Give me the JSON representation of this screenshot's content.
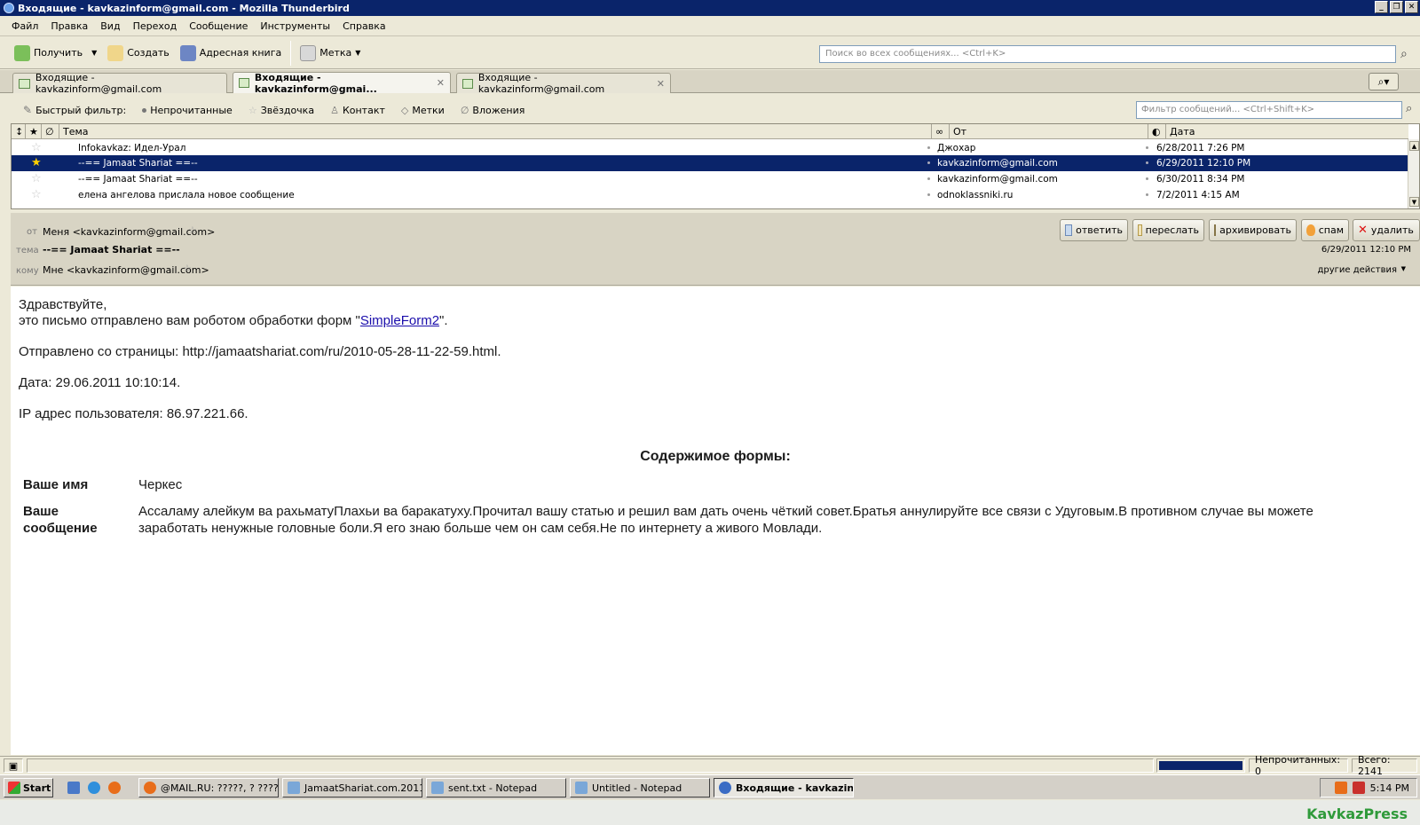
{
  "window": {
    "title": "Входящие - kavkazinform@gmail.com - Mozilla Thunderbird"
  },
  "menu": [
    "Файл",
    "Правка",
    "Вид",
    "Переход",
    "Сообщение",
    "Инструменты",
    "Справка"
  ],
  "toolbar": {
    "get": "Получить",
    "compose": "Создать",
    "addressbook": "Адресная книга",
    "tag": "Метка",
    "search_placeholder": "Поиск во всех сообщениях... <Ctrl+K>"
  },
  "tabs": [
    {
      "label": "Входящие - kavkazinform@gmail.com"
    },
    {
      "label": "Входящие - kavkazinform@gmai..."
    },
    {
      "label": "Входящие - kavkazinform@gmail.com"
    }
  ],
  "quickfilter": {
    "label": "Быстрый фильтр:",
    "unread": "Непрочитанные",
    "starred": "Звёздочка",
    "contact": "Контакт",
    "tags": "Метки",
    "attachments": "Вложения",
    "filter_placeholder": "Фильтр сообщений... <Ctrl+Shift+K>"
  },
  "list": {
    "columns": {
      "subject": "Тема",
      "from": "От",
      "date": "Дата"
    },
    "rows": [
      {
        "subject": "Infokavkaz: Идел-Урал",
        "from": "Джохар",
        "date": "6/28/2011 7:26 PM"
      },
      {
        "subject": "--== Jamaat Shariat ==--",
        "from": "kavkazinform@gmail.com",
        "date": "6/29/2011 12:10 PM"
      },
      {
        "subject": "--== Jamaat Shariat ==--",
        "from": "kavkazinform@gmail.com",
        "date": "6/30/2011 8:34 PM"
      },
      {
        "subject": "елена ангелова прислала новое сообщение",
        "from": "odnoklassniki.ru",
        "date": "7/2/2011 4:15 AM"
      }
    ]
  },
  "header": {
    "from_label": "от",
    "from_value": "Меня <kavkazinform@gmail.com>",
    "subject_label": "тема",
    "subject_value": "--== Jamaat Shariat ==--",
    "to_label": "кому",
    "to_value": "Мне <kavkazinform@gmail.com>",
    "date": "6/29/2011 12:10 PM",
    "other_actions": "другие действия",
    "buttons": {
      "reply": "ответить",
      "forward": "переслать",
      "archive": "архивировать",
      "spam": "спам",
      "delete": "удалить"
    }
  },
  "body": {
    "greeting": "Здравствуйте,",
    "line1_pre": "это письмо отправлено вам роботом обработки форм \"",
    "line1_link": "SimpleForm2",
    "line1_post": "\".",
    "page": "Отправлено со страницы: http://jamaatshariat.com/ru/2010-05-28-11-22-59.html.",
    "date": "Дата: 29.06.2011 10:10:14.",
    "ip": "IP адрес пользователя: 86.97.221.66.",
    "form_heading": "Содержимое формы:",
    "name_label": "Ваше имя",
    "name_value": "Черкес",
    "msg_label_1": "Ваше",
    "msg_label_2": "сообщение",
    "msg_value_1": "Ассаламу алейкум ва рахьматуПлахьи ва баракатуху.Прочитал вашу статью и решил вам дать очень чёткий совет.Братья аннулируйте все связи с Удуговым.В противном случае вы можете",
    "msg_value_2": "заработать ненужные головные боли.Я его знаю больше чем он сам себя.Не по интернету а живого Мовлади."
  },
  "status": {
    "unread": "Непрочитанных: 0",
    "total": "Всего: 2141"
  },
  "taskbar": {
    "start": "Start",
    "items": [
      "@MAIL.RU: ?????, ? ????...",
      "JamaatShariat.com.2011...",
      "sent.txt - Notepad",
      "Untitled - Notepad",
      "Входящие - kavkazin..."
    ],
    "clock": "5:14 PM"
  },
  "watermark": "KavkazPress"
}
